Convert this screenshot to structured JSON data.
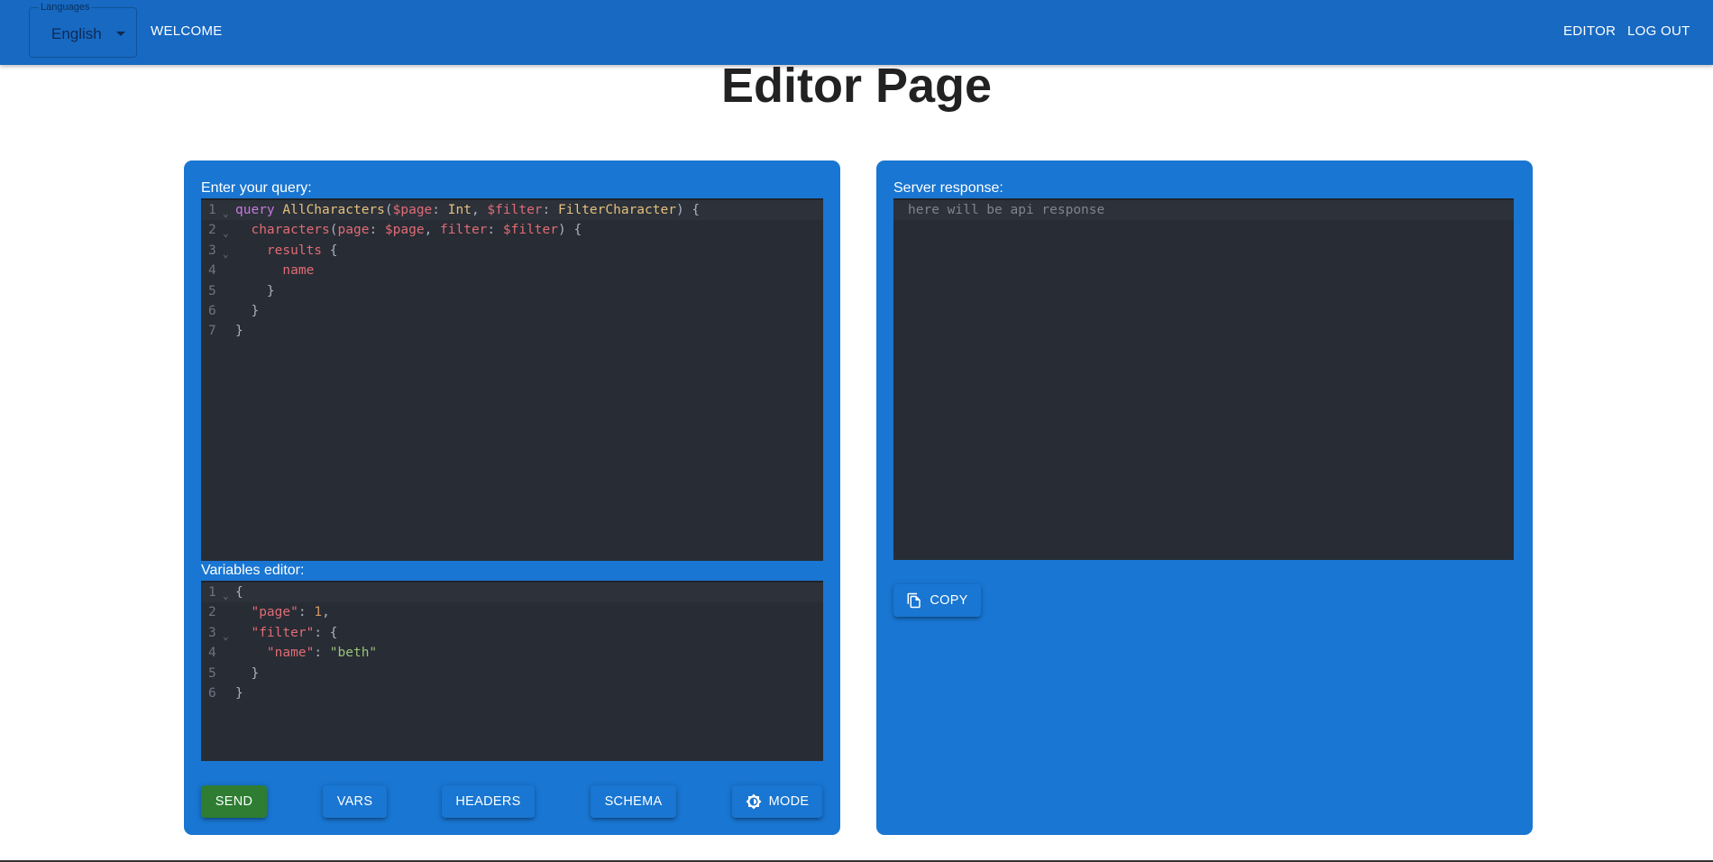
{
  "header": {
    "language_legend": "Languages",
    "language_value": "English",
    "welcome_link": "WELCOME",
    "editor_link": "EDITOR",
    "logout_link": "LOG OUT"
  },
  "page": {
    "title": "Editor Page"
  },
  "query_panel": {
    "label": "Enter your query:",
    "variables_label": "Variables editor:",
    "query_line_numbers": [
      "1",
      "2",
      "3",
      "4",
      "5",
      "6",
      "7"
    ],
    "variables_line_numbers": [
      "1",
      "2",
      "3",
      "4",
      "5",
      "6"
    ]
  },
  "response_panel": {
    "label": "Server response:",
    "placeholder": "here will be api response",
    "copy_label": "COPY"
  },
  "buttons": {
    "send": "SEND",
    "vars": "VARS",
    "headers": "HEADERS",
    "schema": "SCHEMA",
    "mode": "MODE"
  },
  "icons": {
    "fold": "chevron-down-icon",
    "copy": "copy-icon",
    "mode": "brightness-icon"
  },
  "colors": {
    "appbar": "#1769c2",
    "panel": "#1976d2",
    "editor_bg": "#282c34",
    "send_button": "#2e7d32"
  }
}
